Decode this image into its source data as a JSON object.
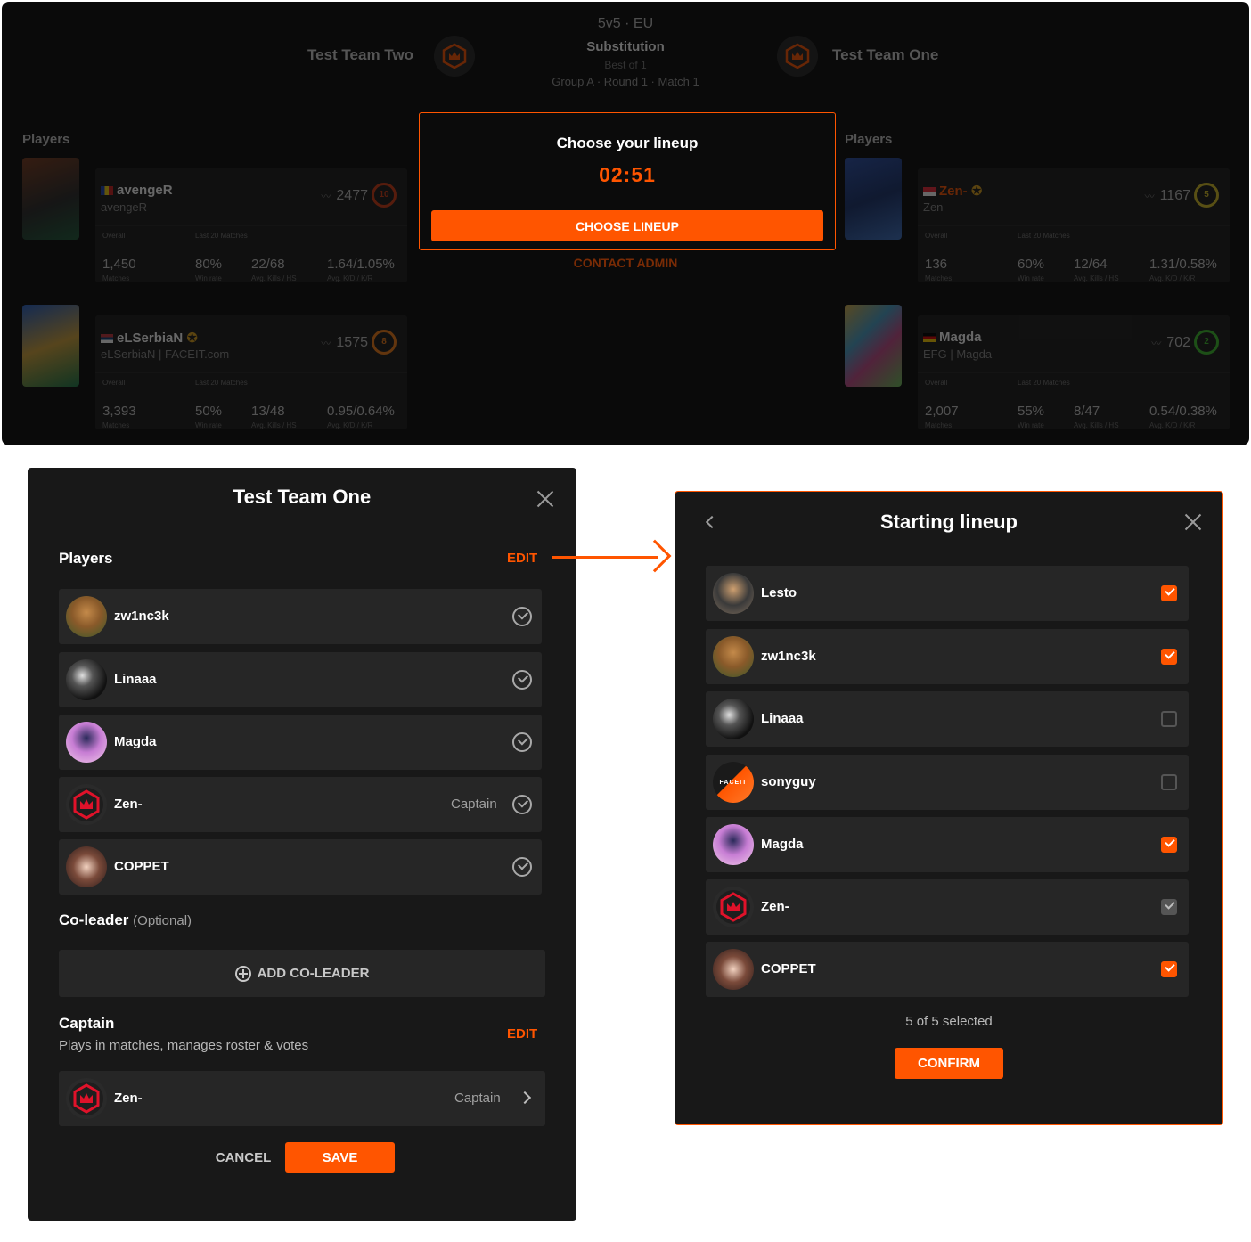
{
  "match": {
    "format": "5v5 · EU",
    "state": "Substitution",
    "best_of": "Best of 1",
    "stage": "Group A · Round 1 · Match 1",
    "team_left": "Test Team Two",
    "team_right": "Test Team One",
    "players_label": "Players",
    "contact_admin": "CONTACT ADMIN",
    "stat_headers": {
      "overall": "Overall",
      "last20": "Last 20 Matches"
    },
    "stat_labels": {
      "matches": "Matches",
      "winrate": "Win rate",
      "kills": "Avg. Kills / HS",
      "kd": "Avg. K/D / K/R"
    },
    "left_players": [
      {
        "nick": "avengeR",
        "sub": "avengeR",
        "elo": "2477",
        "level": "10",
        "matches": "1,450",
        "winrate": "80%",
        "kills": "22/68",
        "kd": "1.64/1.05%"
      },
      {
        "nick": "eLSerbiaN",
        "sub": "eLSerbiaN | FACEIT.com",
        "elo": "1575",
        "level": "8",
        "matches": "3,393",
        "winrate": "50%",
        "kills": "13/48",
        "kd": "0.95/0.64%"
      }
    ],
    "right_players": [
      {
        "nick": "Zen-",
        "sub": "Zen",
        "elo": "1167",
        "level": "5",
        "matches": "136",
        "winrate": "60%",
        "kills": "12/64",
        "kd": "1.31/0.58%"
      },
      {
        "nick": "Magda",
        "sub": "EFG | Magda",
        "elo": "702",
        "level": "2",
        "matches": "2,007",
        "winrate": "55%",
        "kills": "8/47",
        "kd": "0.54/0.38%"
      }
    ]
  },
  "lineup_prompt": {
    "title": "Choose your lineup",
    "timer": "02:51",
    "button": "CHOOSE LINEUP"
  },
  "team_modal": {
    "title": "Test Team One",
    "players_label": "Players",
    "edit_label": "EDIT",
    "players": [
      {
        "name": "zw1nc3k",
        "role": ""
      },
      {
        "name": "Linaaa",
        "role": ""
      },
      {
        "name": "Magda",
        "role": ""
      },
      {
        "name": "Zen-",
        "role": "Captain"
      },
      {
        "name": "COPPET",
        "role": ""
      }
    ],
    "coleader_label": "Co-leader",
    "coleader_optional": "(Optional)",
    "add_coleader": "ADD CO-LEADER",
    "captain_label": "Captain",
    "captain_desc": "Plays in matches, manages roster & votes",
    "captain": {
      "name": "Zen-",
      "role": "Captain"
    },
    "cancel": "CANCEL",
    "save": "SAVE"
  },
  "starting_lineup": {
    "title": "Starting lineup",
    "players": [
      {
        "name": "Lesto",
        "checked": true
      },
      {
        "name": "zw1nc3k",
        "checked": true
      },
      {
        "name": "Linaaa",
        "checked": false
      },
      {
        "name": "sonyguy",
        "checked": false
      },
      {
        "name": "Magda",
        "checked": true
      },
      {
        "name": "Zen-",
        "checked": true
      },
      {
        "name": "COPPET",
        "checked": true
      }
    ],
    "selected_text": "5 of 5 selected",
    "confirm": "CONFIRM"
  },
  "colors": {
    "accent": "#ff5500",
    "bg_dark": "#0a0a0a",
    "panel": "#181818",
    "row": "#262626"
  }
}
